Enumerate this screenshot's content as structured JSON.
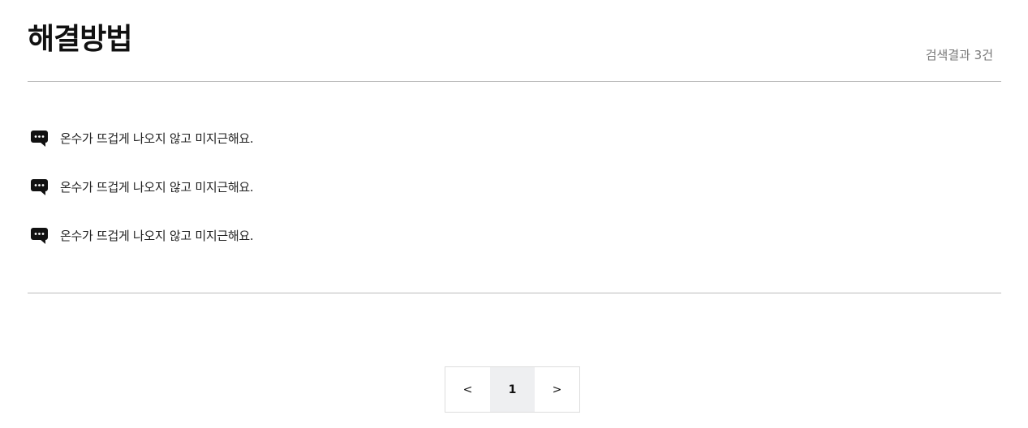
{
  "header": {
    "title": "해결방법",
    "result_count": "검색결과 3건"
  },
  "results": [
    {
      "icon": "chat-bubble-icon",
      "text": "온수가 뜨겁게 나오지 않고 미지근해요."
    },
    {
      "icon": "chat-bubble-icon",
      "text": "온수가 뜨겁게 나오지 않고 미지근해요."
    },
    {
      "icon": "chat-bubble-icon",
      "text": "온수가 뜨겁게 나오지 않고 미지근해요."
    }
  ],
  "pagination": {
    "prev_label": "<",
    "current_page": "1",
    "next_label": ">"
  }
}
